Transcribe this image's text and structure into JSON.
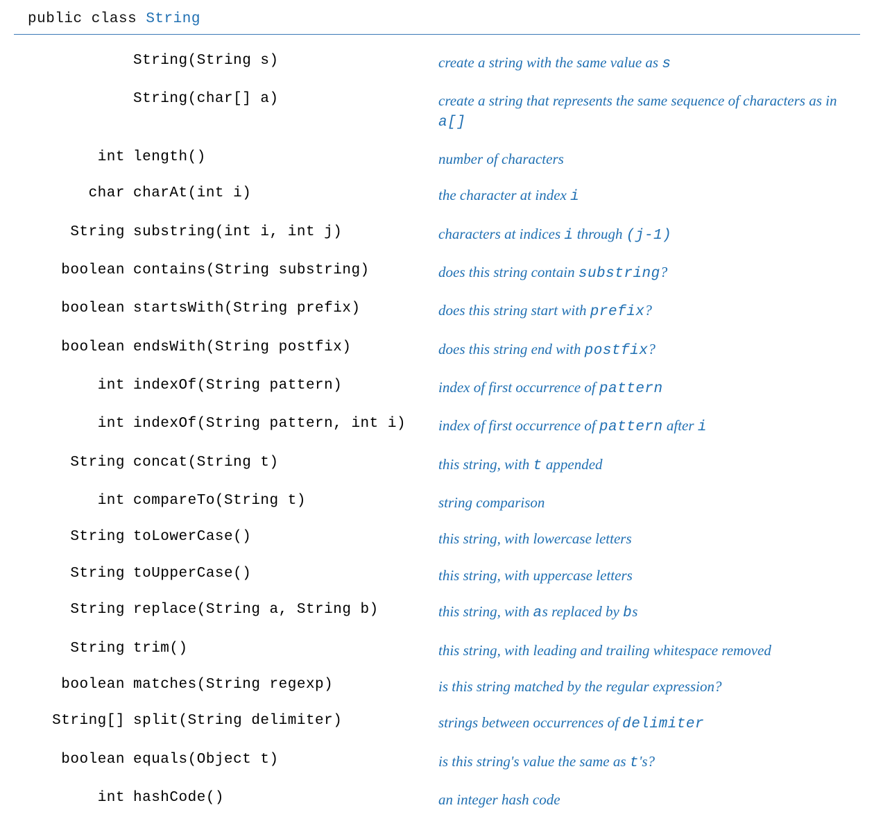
{
  "header": {
    "prefix": "public class ",
    "class_name": "String"
  },
  "rows": [
    {
      "ret": "",
      "sig": "String(String s)",
      "desc": [
        {
          "t": "create a string with the same value as ",
          "c": false
        },
        {
          "t": "s",
          "c": true
        }
      ]
    },
    {
      "ret": "",
      "sig": "String(char[] a)",
      "desc": [
        {
          "t": "create a string that represents the same sequence of characters as in ",
          "c": false
        },
        {
          "t": "a[]",
          "c": true
        }
      ]
    },
    {
      "ret": "int",
      "sig": "length()",
      "desc": [
        {
          "t": "number of characters",
          "c": false
        }
      ]
    },
    {
      "ret": "char",
      "sig": "charAt(int i)",
      "desc": [
        {
          "t": "the character at index ",
          "c": false
        },
        {
          "t": "i",
          "c": true
        }
      ]
    },
    {
      "ret": "String",
      "sig": "substring(int i, int j)",
      "desc": [
        {
          "t": "characters at indices ",
          "c": false
        },
        {
          "t": "i",
          "c": true
        },
        {
          "t": " through ",
          "c": false
        },
        {
          "t": "(j-1)",
          "c": true
        }
      ]
    },
    {
      "ret": "boolean",
      "sig": "contains(String substring)",
      "desc": [
        {
          "t": "does this string contain ",
          "c": false
        },
        {
          "t": "substring",
          "c": true
        },
        {
          "t": "?",
          "c": false
        }
      ]
    },
    {
      "ret": "boolean",
      "sig": "startsWith(String prefix)",
      "desc": [
        {
          "t": "does this string start with ",
          "c": false
        },
        {
          "t": "prefix",
          "c": true
        },
        {
          "t": "?",
          "c": false
        }
      ]
    },
    {
      "ret": "boolean",
      "sig": "endsWith(String postfix)",
      "desc": [
        {
          "t": "does this string end with ",
          "c": false
        },
        {
          "t": "postfix",
          "c": true
        },
        {
          "t": "?",
          "c": false
        }
      ]
    },
    {
      "ret": "int",
      "sig": "indexOf(String pattern)",
      "desc": [
        {
          "t": "index of first occurrence of ",
          "c": false
        },
        {
          "t": "pattern",
          "c": true
        }
      ]
    },
    {
      "ret": "int",
      "sig": "indexOf(String pattern, int i)",
      "desc": [
        {
          "t": "index of first occurrence of ",
          "c": false
        },
        {
          "t": "pattern",
          "c": true
        },
        {
          "t": " after ",
          "c": false
        },
        {
          "t": "i",
          "c": true
        }
      ]
    },
    {
      "ret": "String",
      "sig": "concat(String t)",
      "desc": [
        {
          "t": "this string, with ",
          "c": false
        },
        {
          "t": "t",
          "c": true
        },
        {
          "t": " appended",
          "c": false
        }
      ]
    },
    {
      "ret": "int",
      "sig": "compareTo(String t)",
      "desc": [
        {
          "t": "string comparison",
          "c": false
        }
      ]
    },
    {
      "ret": "String",
      "sig": "toLowerCase()",
      "desc": [
        {
          "t": "this string, with lowercase letters",
          "c": false
        }
      ]
    },
    {
      "ret": "String",
      "sig": "toUpperCase()",
      "desc": [
        {
          "t": "this string, with uppercase letters",
          "c": false
        }
      ]
    },
    {
      "ret": "String",
      "sig": "replace(String a, String b)",
      "desc": [
        {
          "t": "this string, with ",
          "c": false
        },
        {
          "t": "a",
          "c": true
        },
        {
          "t": "s replaced by ",
          "c": false
        },
        {
          "t": "b",
          "c": true
        },
        {
          "t": "s",
          "c": false
        }
      ]
    },
    {
      "ret": "String",
      "sig": "trim()",
      "desc": [
        {
          "t": "this string, with leading and trailing whitespace removed",
          "c": false
        }
      ]
    },
    {
      "ret": "boolean",
      "sig": "matches(String regexp)",
      "desc": [
        {
          "t": "is this string matched by the regular expression?",
          "c": false
        }
      ]
    },
    {
      "ret": "String[]",
      "sig": "split(String delimiter)",
      "desc": [
        {
          "t": "strings between occurrences of ",
          "c": false
        },
        {
          "t": "delimiter",
          "c": true
        }
      ]
    },
    {
      "ret": "boolean",
      "sig": "equals(Object t)",
      "desc": [
        {
          "t": "is this string's value the same as ",
          "c": false
        },
        {
          "t": "t",
          "c": true
        },
        {
          "t": "'s?",
          "c": false
        }
      ]
    },
    {
      "ret": "int",
      "sig": "hashCode()",
      "desc": [
        {
          "t": "an integer hash code",
          "c": false
        }
      ]
    }
  ]
}
